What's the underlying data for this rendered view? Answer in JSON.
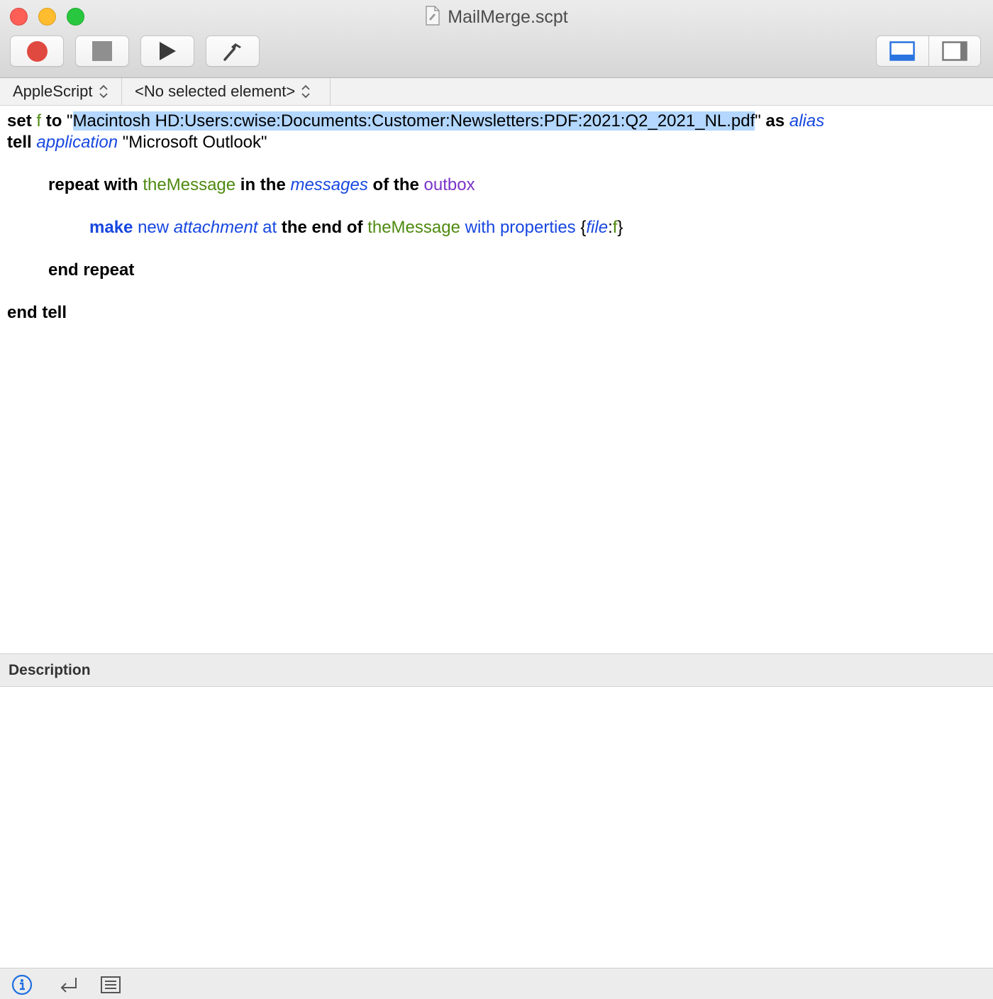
{
  "window": {
    "title": "MailMerge.scpt"
  },
  "toolbar": {
    "buttons": [
      {
        "name": "record",
        "icon": "record-icon"
      },
      {
        "name": "stop",
        "icon": "stop-icon"
      },
      {
        "name": "run",
        "icon": "play-icon"
      },
      {
        "name": "compile",
        "icon": "hammer-icon"
      }
    ],
    "view_toggle": [
      {
        "name": "show-log-pane",
        "icon": "bottom-pane-icon",
        "selected": true
      },
      {
        "name": "show-library-pane",
        "icon": "side-pane-icon",
        "selected": false
      }
    ]
  },
  "navbar": {
    "language": "AppleScript",
    "element": "<No selected element>"
  },
  "script": {
    "l1_set": "set",
    "l1_f": "f",
    "l1_to": "to",
    "l1_quote_open": "\"",
    "l1_path": "Macintosh HD:Users:cwise:Documents:Customer:Newsletters:PDF:2021:Q2_2021_NL.pdf",
    "l1_quote_close": "\"",
    "l1_as": "as",
    "l1_alias": "alias",
    "l2_tell": "tell",
    "l2_application": "application",
    "l2_app_name": "\"Microsoft Outlook\"",
    "l3_repeat_with": "repeat with",
    "l3_theMessage": "theMessage",
    "l3_in_the": "in the",
    "l3_messages": "messages",
    "l3_of_the": "of the",
    "l3_outbox": "outbox",
    "l4_make": "make",
    "l4_new": "new",
    "l4_attachment": "attachment",
    "l4_at": "at",
    "l4_the_end_of": "the end of",
    "l4_theMessage": "theMessage",
    "l4_with_properties": "with properties",
    "l4_brace_open": "{",
    "l4_file": "file",
    "l4_colon": ":",
    "l4_f": "f",
    "l4_brace_close": "}",
    "l5_end_repeat": "end repeat",
    "l6_end_tell": "end tell"
  },
  "colors": {
    "keyword": "#000000",
    "variable": "#4f8a10",
    "class": "#1747e0",
    "enumeration": "#7b34c9",
    "selection": "#b3d7ff",
    "record_button": "#e0493f"
  },
  "description": {
    "header": "Description"
  },
  "bottombar": {
    "buttons": [
      {
        "name": "info",
        "icon": "info-icon"
      },
      {
        "name": "replies",
        "icon": "return-arrow-icon"
      },
      {
        "name": "log",
        "icon": "list-icon"
      }
    ]
  }
}
